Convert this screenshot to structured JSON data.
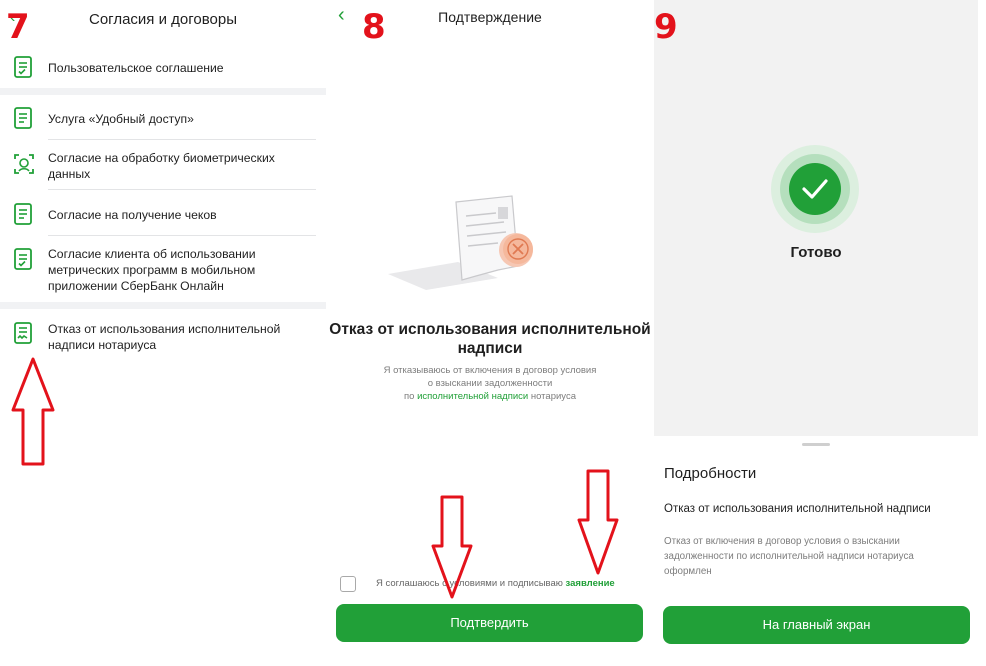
{
  "steps": [
    "7",
    "8",
    "9"
  ],
  "panel7": {
    "back_icon": "chevron-left-icon",
    "title": "Согласия и договоры",
    "items": [
      {
        "label": "Пользовательское соглашение",
        "icon": "document-icon"
      },
      {
        "label": "Услуга «Удобный доступ»",
        "icon": "document-icon"
      },
      {
        "label": "Согласие на обработку биометрических данных",
        "icon": "face-scan-icon"
      },
      {
        "label": "Согласие на получение чеков",
        "icon": "document-icon"
      },
      {
        "label": "Согласие клиента об использовании метрических программ в мобильном приложении СберБанк Онлайн",
        "icon": "document-icon"
      },
      {
        "label": "Отказ от использования исполнительной надписи нотариуса",
        "icon": "signed-document-icon"
      }
    ]
  },
  "panel8": {
    "back_icon": "chevron-left-icon",
    "title": "Подтверждение",
    "heading": "Отказ от использования исполнительной надписи",
    "desc_line1": "Я отказываюсь от включения в договор условия",
    "desc_line2": "о взыскании задолженности",
    "desc_pre": "по",
    "desc_link": "исполнительной надписи",
    "desc_post": "нотариуса",
    "agree_text": "Я соглашаюсь с условиями и подписываю",
    "agree_link": "заявление",
    "checkbox_checked": false,
    "confirm_button": "Подтвердить"
  },
  "panel9": {
    "status": "Готово",
    "sheet_title": "Подробности",
    "sheet_subtitle": "Отказ от использования исполнительной надписи",
    "sheet_desc": "Отказ от включения в договор условия о взыскании задолженности по исполнительной надписи нотариуса оформлен",
    "home_button": "На главный экран"
  },
  "colors": {
    "accent_green": "#21a038",
    "annotation_red": "#e3121b"
  }
}
